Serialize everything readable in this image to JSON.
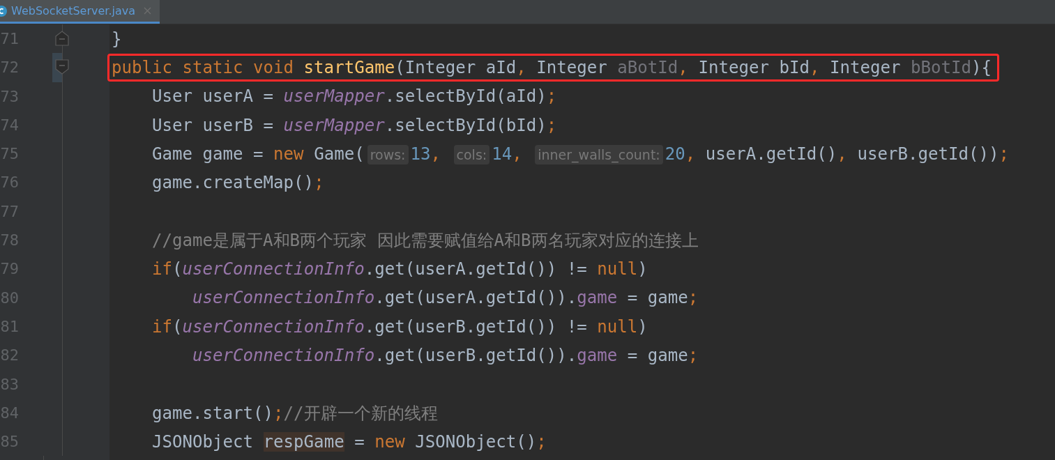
{
  "tabs": [
    {
      "label": "WebSocketServer.java",
      "selected": true
    }
  ],
  "lines": [
    {
      "number": "71",
      "fold_start": false,
      "fold_end": true,
      "tokens": [
        {
          "kind": "plain",
          "t": "}"
        }
      ]
    },
    {
      "number": "72",
      "fold_start": true,
      "fold_end": false,
      "boxed": true,
      "tokens": [
        {
          "kind": "kw",
          "t": "public static void "
        },
        {
          "kind": "method",
          "t": "startGame"
        },
        {
          "kind": "plain",
          "t": "(Integer aId"
        },
        {
          "kind": "punct",
          "t": ", "
        },
        {
          "kind": "plain",
          "t": "Integer "
        },
        {
          "kind": "unused",
          "t": "aBotId"
        },
        {
          "kind": "punct",
          "t": ", "
        },
        {
          "kind": "plain",
          "t": "Integer bId"
        },
        {
          "kind": "punct",
          "t": ", "
        },
        {
          "kind": "plain",
          "t": "Integer "
        },
        {
          "kind": "unused",
          "t": "bBotId"
        },
        {
          "kind": "plain",
          "t": "){"
        }
      ]
    },
    {
      "number": "73",
      "fold_start": false,
      "fold_end": false,
      "tokens": [
        {
          "kind": "plain",
          "t": "    User userA = "
        },
        {
          "kind": "field",
          "t": "userMapper"
        },
        {
          "kind": "plain",
          "t": ".selectById(aId)"
        },
        {
          "kind": "punct",
          "t": ";"
        }
      ]
    },
    {
      "number": "74",
      "fold_start": false,
      "fold_end": false,
      "tokens": [
        {
          "kind": "plain",
          "t": "    User userB = "
        },
        {
          "kind": "field",
          "t": "userMapper"
        },
        {
          "kind": "plain",
          "t": ".selectById(bId)"
        },
        {
          "kind": "punct",
          "t": ";"
        }
      ]
    },
    {
      "number": "75",
      "fold_start": false,
      "fold_end": false,
      "tokens": [
        {
          "kind": "plain",
          "t": "    Game game = "
        },
        {
          "kind": "kw",
          "t": "new "
        },
        {
          "kind": "plain",
          "t": "Game("
        },
        {
          "kind": "hint",
          "t": "rows:"
        },
        {
          "kind": "num",
          "t": "13"
        },
        {
          "kind": "punct",
          "t": ", "
        },
        {
          "kind": "hint",
          "t": "cols:"
        },
        {
          "kind": "num",
          "t": "14"
        },
        {
          "kind": "punct",
          "t": ", "
        },
        {
          "kind": "hint",
          "t": "inner_walls_count:"
        },
        {
          "kind": "num",
          "t": "20"
        },
        {
          "kind": "punct",
          "t": ", "
        },
        {
          "kind": "plain",
          "t": "userA.getId()"
        },
        {
          "kind": "punct",
          "t": ", "
        },
        {
          "kind": "plain",
          "t": "userB.getId())"
        },
        {
          "kind": "punct",
          "t": ";"
        }
      ]
    },
    {
      "number": "76",
      "fold_start": false,
      "fold_end": false,
      "tokens": [
        {
          "kind": "plain",
          "t": "    game.createMap()"
        },
        {
          "kind": "punct",
          "t": ";"
        }
      ]
    },
    {
      "number": "77",
      "fold_start": false,
      "fold_end": false
    },
    {
      "number": "78",
      "fold_start": false,
      "fold_end": false,
      "tokens": [
        {
          "kind": "comment",
          "t": "    //game是属于A和B两个玩家 因此需要赋值给A和B两名玩家对应的连接上"
        }
      ]
    },
    {
      "number": "79",
      "fold_start": false,
      "fold_end": false,
      "tokens": [
        {
          "kind": "kw",
          "t": "    if"
        },
        {
          "kind": "plain",
          "t": "("
        },
        {
          "kind": "field",
          "t": "userConnectionInfo"
        },
        {
          "kind": "plain",
          "t": ".get(userA.getId()) != "
        },
        {
          "kind": "kw",
          "t": "null"
        },
        {
          "kind": "plain",
          "t": ")"
        }
      ]
    },
    {
      "number": "80",
      "fold_start": false,
      "fold_end": false,
      "tokens": [
        {
          "kind": "field",
          "t": "        userConnectionInfo"
        },
        {
          "kind": "plain",
          "t": ".get(userA.getId())."
        },
        {
          "kind": "member",
          "t": "game"
        },
        {
          "kind": "plain",
          "t": " = game"
        },
        {
          "kind": "punct",
          "t": ";"
        }
      ]
    },
    {
      "number": "81",
      "fold_start": false,
      "fold_end": false,
      "tokens": [
        {
          "kind": "kw",
          "t": "    if"
        },
        {
          "kind": "plain",
          "t": "("
        },
        {
          "kind": "field",
          "t": "userConnectionInfo"
        },
        {
          "kind": "plain",
          "t": ".get(userB.getId()) != "
        },
        {
          "kind": "kw",
          "t": "null"
        },
        {
          "kind": "plain",
          "t": ")"
        }
      ]
    },
    {
      "number": "82",
      "fold_start": false,
      "fold_end": false,
      "tokens": [
        {
          "kind": "field",
          "t": "        userConnectionInfo"
        },
        {
          "kind": "plain",
          "t": ".get(userB.getId())."
        },
        {
          "kind": "member",
          "t": "game"
        },
        {
          "kind": "plain",
          "t": " = game"
        },
        {
          "kind": "punct",
          "t": ";"
        }
      ]
    },
    {
      "number": "83",
      "fold_start": false,
      "fold_end": false
    },
    {
      "number": "84",
      "fold_start": false,
      "fold_end": false,
      "tokens": [
        {
          "kind": "plain",
          "t": "    game.start()"
        },
        {
          "kind": "punct",
          "t": ";"
        },
        {
          "kind": "comment",
          "t": "//开辟一个新的线程"
        }
      ]
    },
    {
      "number": "85",
      "fold_start": false,
      "fold_end": false,
      "tokens": [
        {
          "kind": "plain",
          "t": "    JSONObject "
        },
        {
          "kind": "highlight",
          "t": "respGame"
        },
        {
          "kind": "plain",
          "t": " = "
        },
        {
          "kind": "kw",
          "t": "new "
        },
        {
          "kind": "plain",
          "t": "JSONObject()"
        },
        {
          "kind": "punct",
          "t": ";"
        }
      ]
    }
  ]
}
